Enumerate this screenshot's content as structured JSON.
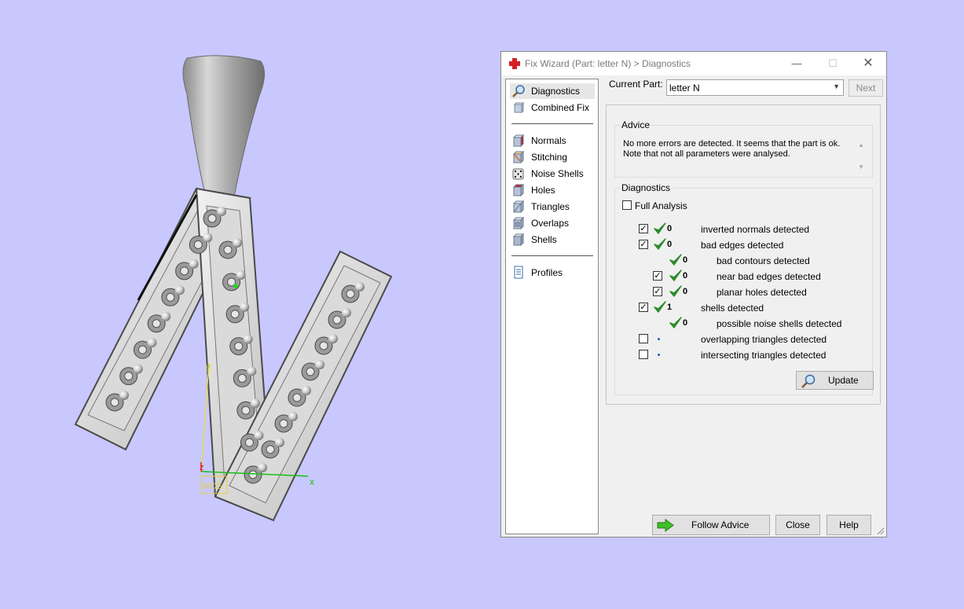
{
  "viewport": {
    "axis_labels": {
      "x": "x",
      "y": "y",
      "z": "z"
    },
    "wcs_label": "WCS"
  },
  "window": {
    "title": "Fix Wizard (Part: letter N) > Diagnostics",
    "controls": {
      "minimize": "—",
      "maximize": "☐",
      "close": "✕"
    }
  },
  "nav": {
    "top_items": [
      {
        "label": "Diagnostics",
        "icon": "magnifier-icon",
        "selected": true
      },
      {
        "label": "Combined Fix",
        "icon": "cube-icon"
      }
    ],
    "fix_items": [
      {
        "label": "Normals",
        "icon": "normals-cube-icon"
      },
      {
        "label": "Stitching",
        "icon": "stitching-cube-icon"
      },
      {
        "label": "Noise Shells",
        "icon": "noise-dice-icon"
      },
      {
        "label": "Holes",
        "icon": "holes-cube-icon"
      },
      {
        "label": "Triangles",
        "icon": "triangles-cube-icon"
      },
      {
        "label": "Overlaps",
        "icon": "overlaps-cube-icon"
      },
      {
        "label": "Shells",
        "icon": "shells-cube-icon"
      }
    ],
    "bottom_items": [
      {
        "label": "Profiles",
        "icon": "document-icon"
      }
    ]
  },
  "current_part": {
    "label": "Current Part:",
    "value": "letter N"
  },
  "next_label": "Next",
  "advice": {
    "title": "Advice",
    "line1": "No more errors are detected. It seems that the part is ok.",
    "line2": "Note that not all parameters were analysed."
  },
  "diagnostics": {
    "title": "Diagnostics",
    "full_analysis_label": "Full Analysis",
    "full_analysis_checked": false,
    "rows": [
      {
        "label": "inverted normals detected",
        "count": "0",
        "checkbox": true,
        "checked": true,
        "status": "ok"
      },
      {
        "label": "bad edges detected",
        "count": "0",
        "checkbox": true,
        "checked": true,
        "status": "ok"
      },
      {
        "label": "bad contours detected",
        "count": "0",
        "checkbox": false,
        "checked": false,
        "status": "ok"
      },
      {
        "label": "near bad edges detected",
        "count": "0",
        "checkbox": true,
        "checked": true,
        "status": "ok"
      },
      {
        "label": "planar holes detected",
        "count": "0",
        "checkbox": true,
        "checked": true,
        "status": "ok"
      },
      {
        "label": "shells detected",
        "count": "1",
        "checkbox": true,
        "checked": true,
        "status": "ok"
      },
      {
        "label": "possible noise shells detected",
        "count": "0",
        "checkbox": false,
        "checked": false,
        "status": "ok"
      },
      {
        "label": "overlapping triangles detected",
        "count": "",
        "checkbox": true,
        "checked": false,
        "status": "not-analysed"
      },
      {
        "label": "intersecting triangles detected",
        "count": "",
        "checkbox": true,
        "checked": false,
        "status": "not-analysed"
      }
    ],
    "update_label": "Update"
  },
  "buttons": {
    "follow_advice": "Follow Advice",
    "close": "Close",
    "help": "Help"
  },
  "colors": {
    "background": "#c8c8ff",
    "check_green": "#2e8b2e",
    "dialog_bg": "#f0f0f0"
  }
}
